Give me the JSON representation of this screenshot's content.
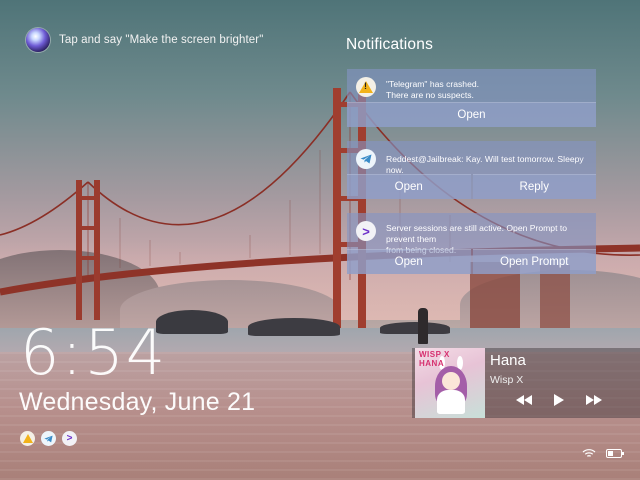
{
  "siri": {
    "hint": "Tap and say \"Make the screen brighter\"",
    "icon": "siri-orb-icon"
  },
  "notifications": {
    "title": "Notifications",
    "items": [
      {
        "icon": "warning-icon",
        "text_line1": "\"Telegram\" has crashed.",
        "text_line2": "There are no suspects.",
        "actions": [
          "Open"
        ]
      },
      {
        "icon": "telegram-icon",
        "text_line1": "Reddest@Jailbreak: Kay. Will test tomorrow. Sleepy now.",
        "text_line2": "",
        "actions": [
          "Open",
          "Reply"
        ]
      },
      {
        "icon": "prompt-icon",
        "text_line1": "Server sessions are still active. Open Prompt to prevent them",
        "text_line2": "from being closed.",
        "actions": [
          "Open",
          "Open Prompt"
        ]
      }
    ]
  },
  "lockscreen": {
    "time": "6:54",
    "date": "Wednesday, June 21",
    "notification_icons": [
      "warning-icon",
      "telegram-icon",
      "prompt-icon"
    ]
  },
  "now_playing": {
    "track": "Hana",
    "artist": "Wisp X",
    "album_art_text": "WISP X\nHANA",
    "controls": [
      "rewind",
      "play",
      "fast-forward"
    ]
  },
  "status": {
    "wifi": "wifi-icon",
    "battery_level": 0.4
  },
  "colors": {
    "card_bg": "#8494c4",
    "prompt_accent": "#6c2fc9",
    "telegram_accent": "#3a8bc8",
    "warning_accent": "#f2b21a"
  }
}
